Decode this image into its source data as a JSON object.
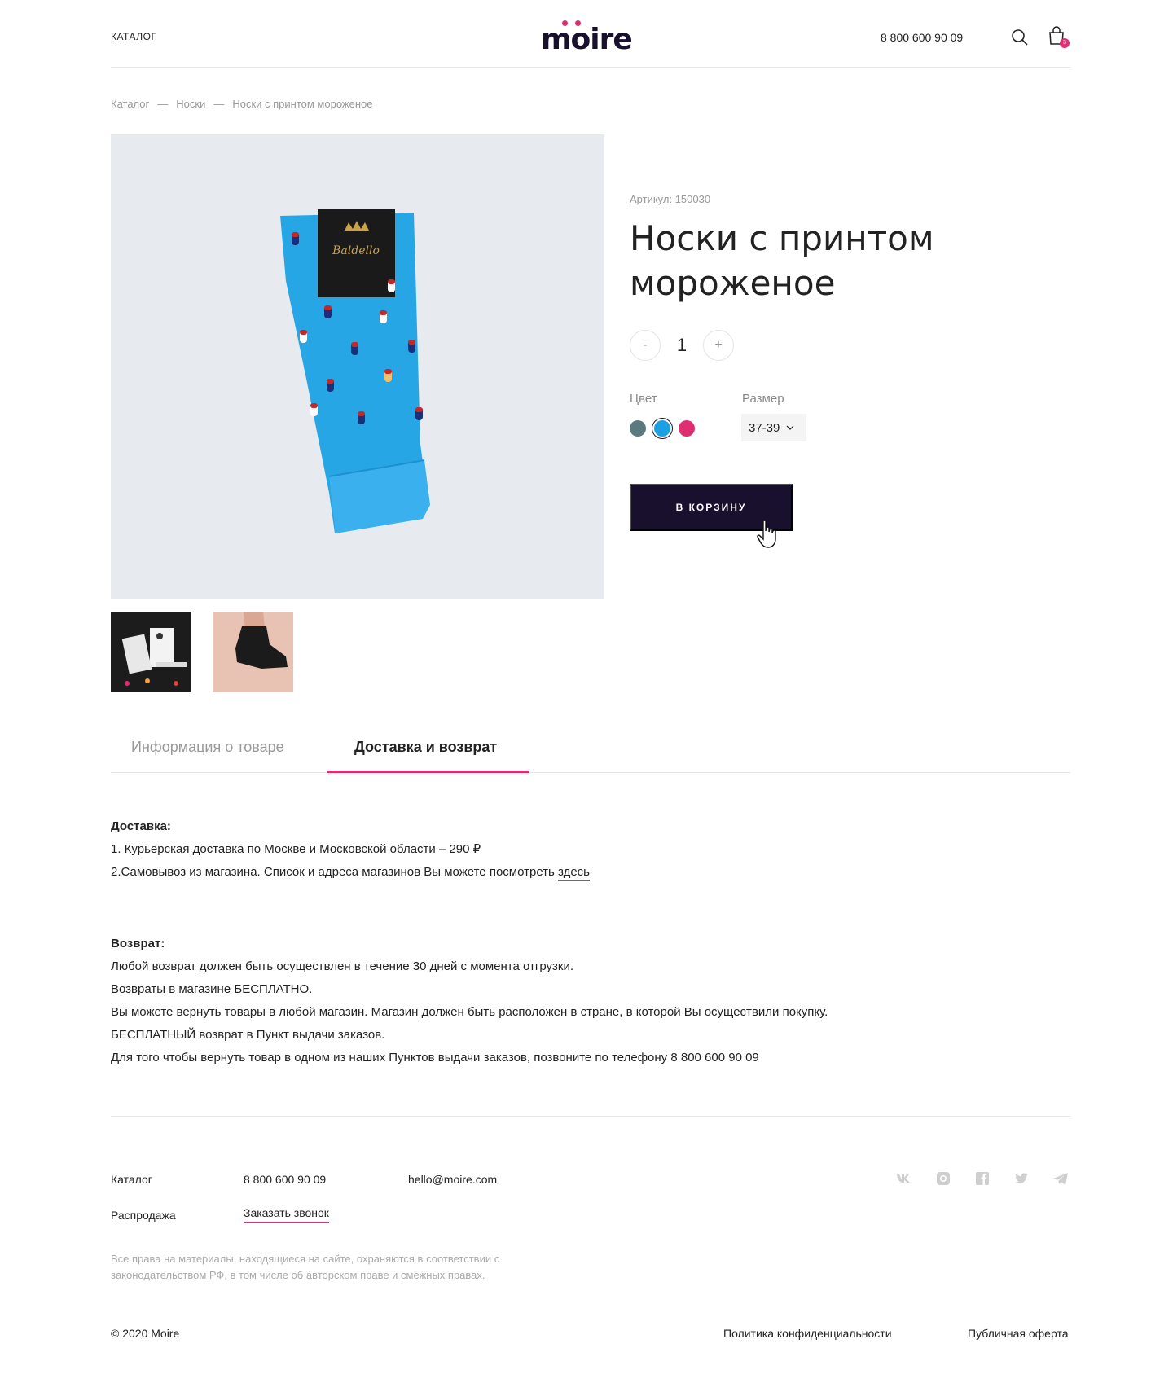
{
  "header": {
    "catalog_label": "КАТАЛОГ",
    "logo_text": "moire",
    "phone": "8 800 600 90 09",
    "cart_count": "3"
  },
  "breadcrumb": [
    "Каталог",
    "—",
    "Носки",
    "—",
    "Носки с принтом мороженое"
  ],
  "product": {
    "article": "Артикул: 150030",
    "title": "Носки с принтом мороженое",
    "qty_minus": "-",
    "qty_value": "1",
    "qty_plus": "+",
    "color_label": "Цвет",
    "size_label": "Размер",
    "colors": [
      "#5b7a80",
      "#1c9fe3",
      "#e02e72"
    ],
    "selected_color": "#1c9fe3",
    "size_value": "37-39",
    "add_to_cart": "В КОРЗИНУ",
    "main_image": "blue-socks-icecream-photo",
    "sock_brand": "Baldello",
    "thumbnails": [
      "socks-box-photo",
      "black-ankle-socks-photo"
    ]
  },
  "tabs": [
    {
      "label": "Информация о товаре",
      "active": false
    },
    {
      "label": "Доставка и возврат",
      "active": true
    }
  ],
  "content": {
    "delivery_title": "Доставка:",
    "delivery_line1": "1. Курьерская доставка по Москве и Московской области – 290 ₽",
    "delivery_line2": "2.Самовывоз из магазина. Список и адреса магазинов Вы можете посмотреть",
    "delivery_link": "здесь",
    "return_title": "Возврат:",
    "return_lines": [
      "Любой возврат должен быть осуществлен в течение 30 дней с момента отгрузки.",
      "Возвраты в магазине БЕСПЛАТНО.",
      "Вы можете вернуть товары в любой магазин. Магазин должен быть расположен в стране, в которой Вы осуществили покупку.",
      "БЕСПЛАТНЫЙ возврат в Пункт выдачи заказов.",
      "Для того чтобы вернуть товар в одном из наших Пунктов выдачи заказов, позвоните по телефону 8 800 600 90 09"
    ]
  },
  "footer": {
    "catalog": "Каталог",
    "sale": "Распродажа",
    "phone": "8 800 600 90 09",
    "callback": "Заказать звонок",
    "email": "hello@moire.com",
    "note": "Все права на материалы, находящиеся на сайте, охраняются в соответствии с законодательством РФ, в том числе об авторском праве и смежных правах.",
    "copyright": "© 2020 Moire",
    "privacy": "Политика конфиденциальности",
    "offer": "Публичная оферта",
    "socials": [
      "vk-icon",
      "instagram-icon",
      "facebook-icon",
      "twitter-icon",
      "telegram-icon"
    ]
  },
  "colors": {
    "accent": "#e02e72",
    "dark": "#19102e",
    "muted": "#999999"
  }
}
